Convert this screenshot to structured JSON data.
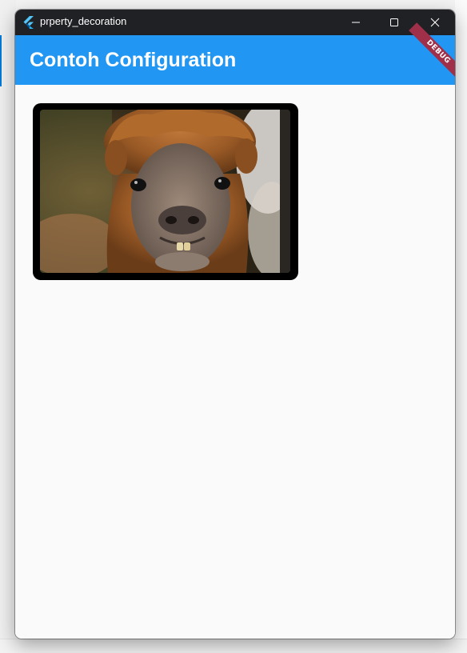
{
  "window": {
    "title": "prperty_decoration"
  },
  "appbar": {
    "title": "Contoh Configuration",
    "color": "#2196f3",
    "debug_banner": "DEBUG"
  },
  "content": {
    "image": {
      "subject": "alpaca",
      "frame_color": "#000000"
    }
  },
  "icons": {
    "app": "flutter-logo-icon",
    "minimize": "minimize-icon",
    "maximize": "maximize-icon",
    "close": "close-icon"
  }
}
